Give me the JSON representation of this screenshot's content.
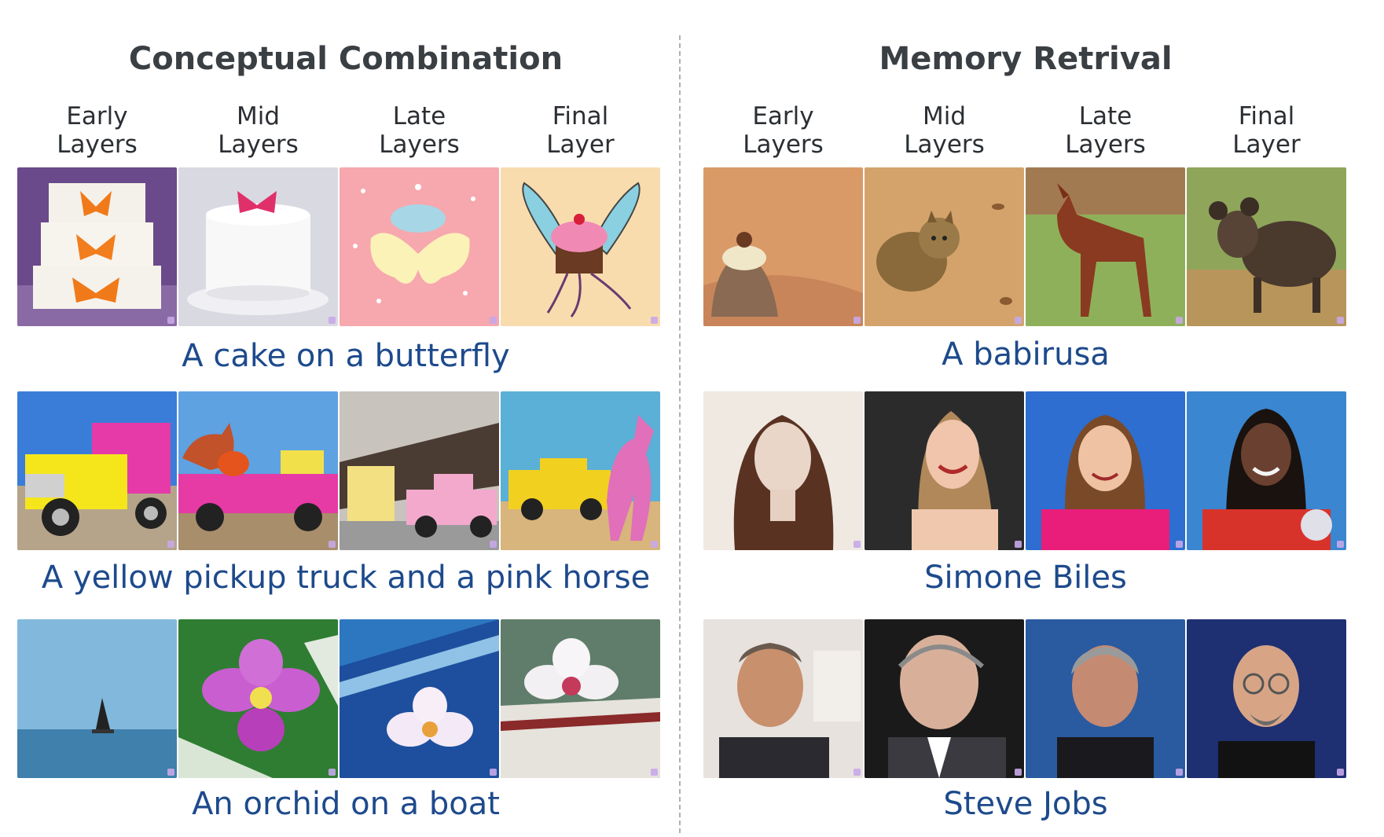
{
  "left": {
    "title": "Conceptual Combination",
    "columns": [
      {
        "line1": "Early",
        "line2": "Layers"
      },
      {
        "line1": "Mid",
        "line2": "Layers"
      },
      {
        "line1": "Late",
        "line2": "Layers"
      },
      {
        "line1": "Final",
        "line2": "Layer"
      }
    ],
    "rows": [
      {
        "caption": "A cake on a butterfly"
      },
      {
        "caption": "A yellow pickup truck and a pink horse"
      },
      {
        "caption": "An orchid on a boat"
      }
    ]
  },
  "right": {
    "title": "Memory Retrival",
    "columns": [
      {
        "line1": "Early",
        "line2": "Layers"
      },
      {
        "line1": "Mid",
        "line2": "Layers"
      },
      {
        "line1": "Late",
        "line2": "Layers"
      },
      {
        "line1": "Final",
        "line2": "Layer"
      }
    ],
    "rows": [
      {
        "caption": "A babirusa"
      },
      {
        "caption": "Simone Biles"
      },
      {
        "caption": "Steve Jobs"
      }
    ]
  }
}
